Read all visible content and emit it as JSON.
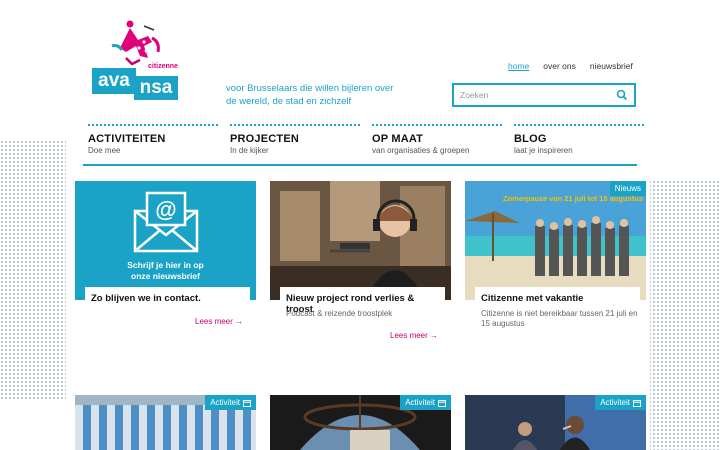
{
  "brand": {
    "citizenne": "citizenne",
    "logo_part1": "ava",
    "logo_part2": "nsa",
    "tagline": "voor Brusselaars die willen bijleren over de wereld, de stad en zichzelf",
    "accent_color": "#1aa3c7",
    "magenta_color": "#c4006d"
  },
  "topnav": {
    "items": [
      {
        "label": "home",
        "active": true
      },
      {
        "label": "over ons",
        "active": false
      },
      {
        "label": "nieuwsbrief",
        "active": false
      }
    ]
  },
  "search": {
    "placeholder": "Zoeken",
    "icon": "search-icon"
  },
  "mainnav": [
    {
      "title": "ACTIVITEITEN",
      "subtitle": "Doe mee"
    },
    {
      "title": "PROJECTEN",
      "subtitle": "In de kijker"
    },
    {
      "title": "OP MAAT",
      "subtitle": "van organisaties & groepen"
    },
    {
      "title": "BLOG",
      "subtitle": "laat je inspireren"
    }
  ],
  "cards": [
    {
      "title": "Zo blijven we in contact.",
      "subtitle": "",
      "readmore": "Lees meer",
      "badge": "",
      "image_text_line1": "Schrijf je hier in op",
      "image_text_line2": "onze nieuwsbrief",
      "image_icon": "email-envelope-icon"
    },
    {
      "title": "Nieuw project rond verlies & troost",
      "subtitle": "Podcast & reizende troostplek",
      "readmore": "Lees meer",
      "badge": ""
    },
    {
      "title": "Citizenne met vakantie",
      "subtitle": "Citizenne is niet bereikbaar tussen 21 juli en 15 augustus",
      "readmore": "",
      "badge": "Nieuws",
      "image_banner": "Zomerpauze van 21 juli tot 15 augustus"
    }
  ],
  "bottom_cards": [
    {
      "badge": "Activiteit"
    },
    {
      "badge": "Activiteit"
    },
    {
      "badge": "Activiteit"
    }
  ]
}
